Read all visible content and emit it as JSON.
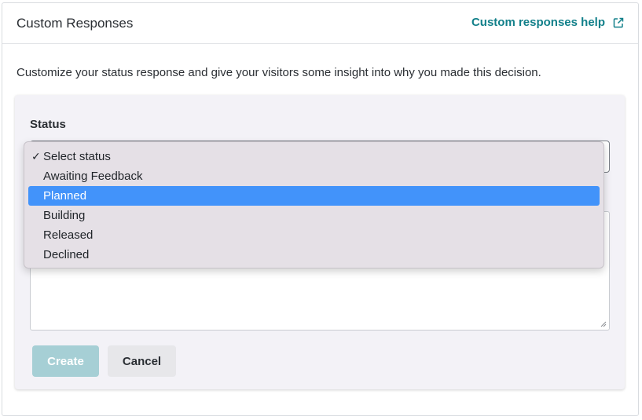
{
  "header": {
    "title": "Custom Responses",
    "help_link": "Custom responses help",
    "help_icon": "external-link-icon"
  },
  "description": "Customize your status response and give your visitors some insight into why you made this decision.",
  "form": {
    "status_label": "Status",
    "status_options": [
      {
        "label": "Select status",
        "checked": true,
        "highlighted": false
      },
      {
        "label": "Awaiting Feedback",
        "checked": false,
        "highlighted": false
      },
      {
        "label": "Planned",
        "checked": false,
        "highlighted": true
      },
      {
        "label": "Building",
        "checked": false,
        "highlighted": false
      },
      {
        "label": "Released",
        "checked": false,
        "highlighted": false
      },
      {
        "label": "Declined",
        "checked": false,
        "highlighted": false
      }
    ],
    "check_glyph": "✓",
    "create_label": "Create",
    "cancel_label": "Cancel"
  },
  "colors": {
    "accent_link": "#12808a",
    "highlight": "#4293fa",
    "create_disabled": "#a6cfd5"
  }
}
